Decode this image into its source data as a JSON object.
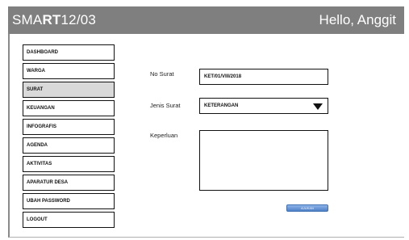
{
  "header": {
    "brand_prefix": "SMA",
    "brand_bold": "RT",
    "brand_suffix": "12/03",
    "greeting": "Hello, Anggit"
  },
  "sidebar": {
    "items": [
      {
        "label": "DASHBOARD"
      },
      {
        "label": "WARGA"
      },
      {
        "label": "SURAT",
        "active": true
      },
      {
        "label": "KEUANGAN"
      },
      {
        "label": "INFOGRAFIS"
      },
      {
        "label": "AGENDA"
      },
      {
        "label": "AKTIVITAS"
      },
      {
        "label": "APARATUR DESA"
      },
      {
        "label": "UBAH PASSWORD"
      },
      {
        "label": "LOGOUT"
      }
    ]
  },
  "form": {
    "no_surat_label": "No Surat",
    "no_surat_value": "KET/01/VIII/2018",
    "jenis_surat_label": "Jenis Surat",
    "jenis_surat_value": "KETERANGAN",
    "keperluan_label": "Keperluan",
    "keperluan_value": "",
    "submit_label": "AJUKAN"
  },
  "colors": {
    "header_bg": "#7f7f7f",
    "active_nav_bg": "#d9d9d9",
    "button_blue": "#4f81c7"
  }
}
